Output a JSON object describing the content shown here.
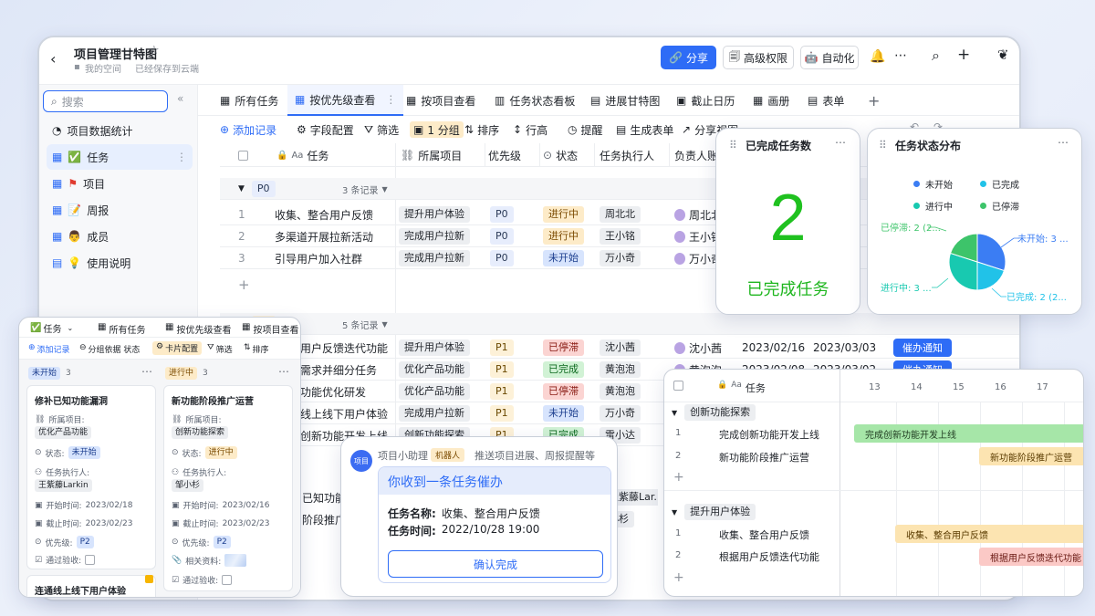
{
  "window": {
    "title": "项目管理甘特图",
    "breadcrumb_space": "我的空间",
    "save_status": "已经保存到云端",
    "share_label": "分享",
    "permission_label": "高级权限",
    "automation_label": "自动化"
  },
  "sidebar": {
    "search_placeholder": "搜索",
    "items": [
      {
        "label": "项目数据统计"
      },
      {
        "label": "任务"
      },
      {
        "label": "项目"
      },
      {
        "label": "周报"
      },
      {
        "label": "成员"
      },
      {
        "label": "使用说明"
      }
    ]
  },
  "tabs": [
    "所有任务",
    "按优先级查看",
    "按项目查看",
    "任务状态看板",
    "进展甘特图",
    "截止日历",
    "画册",
    "表单"
  ],
  "toolbar": [
    "添加记录",
    "字段配置",
    "筛选",
    "1 分组",
    "排序",
    "行高",
    "提醒",
    "生成表单",
    "分享视图"
  ],
  "table": {
    "columns": [
      "任务",
      "所属项目",
      "优先级",
      "状态",
      "任务执行人",
      "负责人账号"
    ],
    "groups": [
      {
        "name": "P0",
        "count": "3 条记录",
        "rows": [
          {
            "num": "1",
            "task": "收集、整合用户反馈",
            "project": "提升用户体验",
            "priority": "P0",
            "status": "进行中",
            "assignee": "周北北",
            "account": "周北北"
          },
          {
            "num": "2",
            "task": "多渠道开展拉新活动",
            "project": "完成用户拉新",
            "priority": "P0",
            "status": "进行中",
            "assignee": "王小铭",
            "account": "王小铭"
          },
          {
            "num": "3",
            "task": "引导用户加入社群",
            "project": "完成用户拉新",
            "priority": "P0",
            "status": "未开始",
            "assignee": "万小奇",
            "account": "万小奇"
          }
        ]
      },
      {
        "name": "P1",
        "count": "5 条记录",
        "rows": [
          {
            "task": "用户反馈迭代功能",
            "project": "提升用户体验",
            "priority": "P1",
            "status": "已停滞",
            "assignee": "沈小茜",
            "account": "沈小茜",
            "start": "2023/02/16",
            "end": "2023/03/03",
            "action": "催办通知"
          },
          {
            "task": "需求并细分任务",
            "project": "优化产品功能",
            "priority": "P1",
            "status": "已完成",
            "assignee": "黄泡泡",
            "account": "黄泡泡",
            "start": "2023/02/08",
            "end": "2023/03/02",
            "action": "催办通知"
          },
          {
            "task": "功能优化研发",
            "project": "优化产品功能",
            "priority": "P1",
            "status": "已停滞",
            "assignee": "黄泡泡"
          },
          {
            "task": "线上线下用户体验",
            "project": "完成用户拉新",
            "priority": "P1",
            "status": "未开始",
            "assignee": "万小奇"
          },
          {
            "task": "创新功能开发上线",
            "project": "创新功能探索",
            "priority": "P1",
            "status": "已完成",
            "assignee": "雷小达"
          }
        ]
      }
    ],
    "partial_rows": [
      {
        "task": "已知功能漏",
        "account": "王紫藤Lar..."
      },
      {
        "task": "阶段推广",
        "account": "小杉"
      }
    ]
  },
  "kanban": {
    "view_name": "任务",
    "tabs": [
      "所有任务",
      "按优先级查看",
      "按项目查看"
    ],
    "toolbar": [
      "添加记录",
      "分组依据 状态",
      "卡片配置",
      "筛选",
      "排序"
    ],
    "columns": [
      {
        "name": "未开始",
        "count": "3",
        "card": {
          "title": "修补已知功能漏洞",
          "project_label": "所属项目:",
          "project": "优化产品功能",
          "status_label": "状态:",
          "status": "未开始",
          "assignee_label": "任务执行人:",
          "assignee": "王紫藤Larkin",
          "start_label": "开始时间:",
          "start": "2023/02/18",
          "end_label": "截止时间:",
          "end": "2023/02/23",
          "priority_label": "优先级:",
          "priority": "P2",
          "accept_label": "通过验收:"
        },
        "next_card": "连通线上线下用户体验"
      },
      {
        "name": "进行中",
        "count": "3",
        "card": {
          "title": "新功能阶段推广运营",
          "project_label": "所属项目:",
          "project": "创新功能探索",
          "status_label": "状态:",
          "status": "进行中",
          "assignee_label": "任务执行人:",
          "assignee": "邹小杉",
          "start_label": "开始时间:",
          "start": "2023/02/16",
          "end_label": "截止时间:",
          "end": "2023/02/23",
          "priority_label": "优先级:",
          "priority": "P2",
          "attach_label": "相关资料:",
          "accept_label": "通过验收:"
        }
      }
    ]
  },
  "metric": {
    "title": "已完成任务数",
    "value": "2",
    "caption": "已完成任务"
  },
  "pie_chart": {
    "title": "任务状态分布",
    "legend": [
      {
        "name": "未开始",
        "color": "#3b7df3"
      },
      {
        "name": "已完成",
        "color": "#21c2e8"
      },
      {
        "name": "进行中",
        "color": "#18c9b0"
      },
      {
        "name": "已停滞",
        "color": "#3dc46a"
      }
    ],
    "labels": {
      "未开始": "未开始: 3 ...",
      "已完成": "已完成: 2 (2...",
      "进行中": "进行中: 3 ...",
      "已停滞": "已停滞: 2 (2..."
    }
  },
  "chart_data": {
    "type": "pie",
    "title": "任务状态分布",
    "categories": [
      "未开始",
      "已完成",
      "进行中",
      "已停滞"
    ],
    "values": [
      3,
      2,
      3,
      2
    ],
    "colors": [
      "#3b7df3",
      "#21c2e8",
      "#18c9b0",
      "#3dc46a"
    ],
    "legend_position": "top"
  },
  "bot": {
    "avatar_text": "项目",
    "name": "项目小助理",
    "badge": "机器人",
    "desc": "推送项目进展、周报提醒等",
    "header": "你收到一条任务催办",
    "task_label": "任务名称:",
    "task_value": "收集、整合用户反馈",
    "time_label": "任务时间:",
    "time_value": "2022/10/28 19:00",
    "confirm": "确认完成"
  },
  "gantt": {
    "column_label": "任务",
    "days": [
      "13",
      "14",
      "15",
      "16",
      "17"
    ],
    "groups": [
      {
        "name": "创新功能探索",
        "rows": [
          {
            "num": "1",
            "task": "完成创新功能开发上线",
            "bar": "完成创新功能开发上线"
          },
          {
            "num": "2",
            "task": "新功能阶段推广运营",
            "bar": "新功能阶段推广运营"
          }
        ]
      },
      {
        "name": "提升用户体验",
        "rows": [
          {
            "num": "1",
            "task": "收集、整合用户反馈",
            "bar": "收集、整合用户反馈"
          },
          {
            "num": "2",
            "task": "根据用户反馈迭代功能",
            "bar": "根据用户反馈迭代功能"
          }
        ]
      }
    ]
  }
}
